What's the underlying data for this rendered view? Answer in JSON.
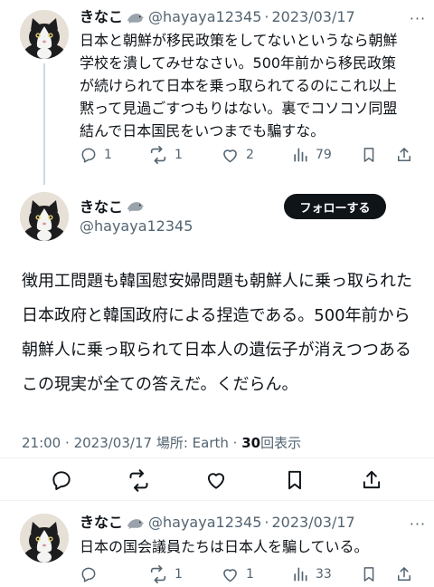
{
  "tweet1": {
    "name": "きなこ",
    "handle": "@hayaya12345",
    "separator": "·",
    "date": "2023/03/17",
    "text": "日本と朝鮮が移民政策をしてないというなら朝鮮学校を潰してみせなさい。500年前から移民政策が続けられて日本を乗っ取られてるのにこれ以上黙って見過ごすつもりはない。裏でコソコソ同盟結んで日本国民をいつまでも騙すな。",
    "replies": "1",
    "retweets": "1",
    "likes": "2",
    "views": "79"
  },
  "main": {
    "name": "きなこ",
    "handle": "@hayaya12345",
    "follow_label": "フォローする",
    "text": "徴用工問題も韓国慰安婦問題も朝鮮人に乗っ取られた日本政府と韓国政府による捏造である。500年前から朝鮮人に乗っ取られて日本人の遺伝子が消えつつあるこの現実が全ての答えだ。くだらん。",
    "time": "21:00",
    "separator": "·",
    "date": "2023/03/17",
    "location": "場所: Earth",
    "view_count": "30",
    "view_label": "回表示"
  },
  "tweet3": {
    "name": "きなこ",
    "handle": "@hayaya12345",
    "separator": "·",
    "date": "2023/03/17",
    "text": "日本の国会議員たちは日本人を騙している。",
    "replies": "",
    "retweets": "1",
    "likes": "1",
    "views": "33"
  },
  "icons": {
    "reply": "reply-icon",
    "retweet": "retweet-icon",
    "like": "heart-icon",
    "views": "views-icon",
    "bookmark": "bookmark-icon",
    "share": "share-icon",
    "more": "more-icon",
    "seal": "seal-emoji-icon"
  },
  "colors": {
    "text": "#0f1419",
    "secondary": "#536471",
    "thread_line": "#cfd9de",
    "follow_bg": "#0f1419"
  }
}
